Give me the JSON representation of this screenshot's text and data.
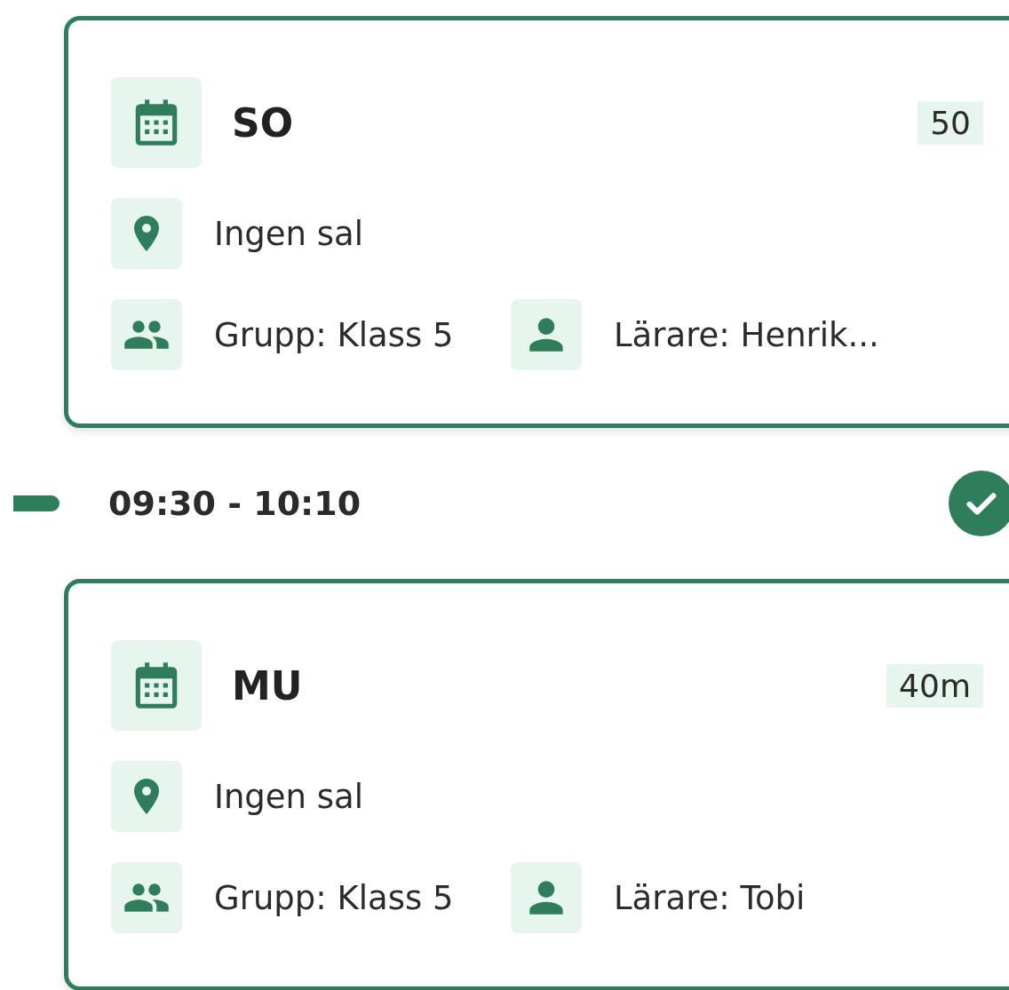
{
  "lessons": [
    {
      "title": "SO",
      "duration": "50",
      "location": "Ingen sal",
      "group": "Grupp: Klass 5",
      "teacher": "Lärare: Henrik..."
    },
    {
      "time": "09:30 - 10:10",
      "done": true,
      "title": "MU",
      "duration": "40m",
      "location": "Ingen sal",
      "group": "Grupp: Klass 5",
      "teacher": "Lärare: Tobi"
    }
  ]
}
